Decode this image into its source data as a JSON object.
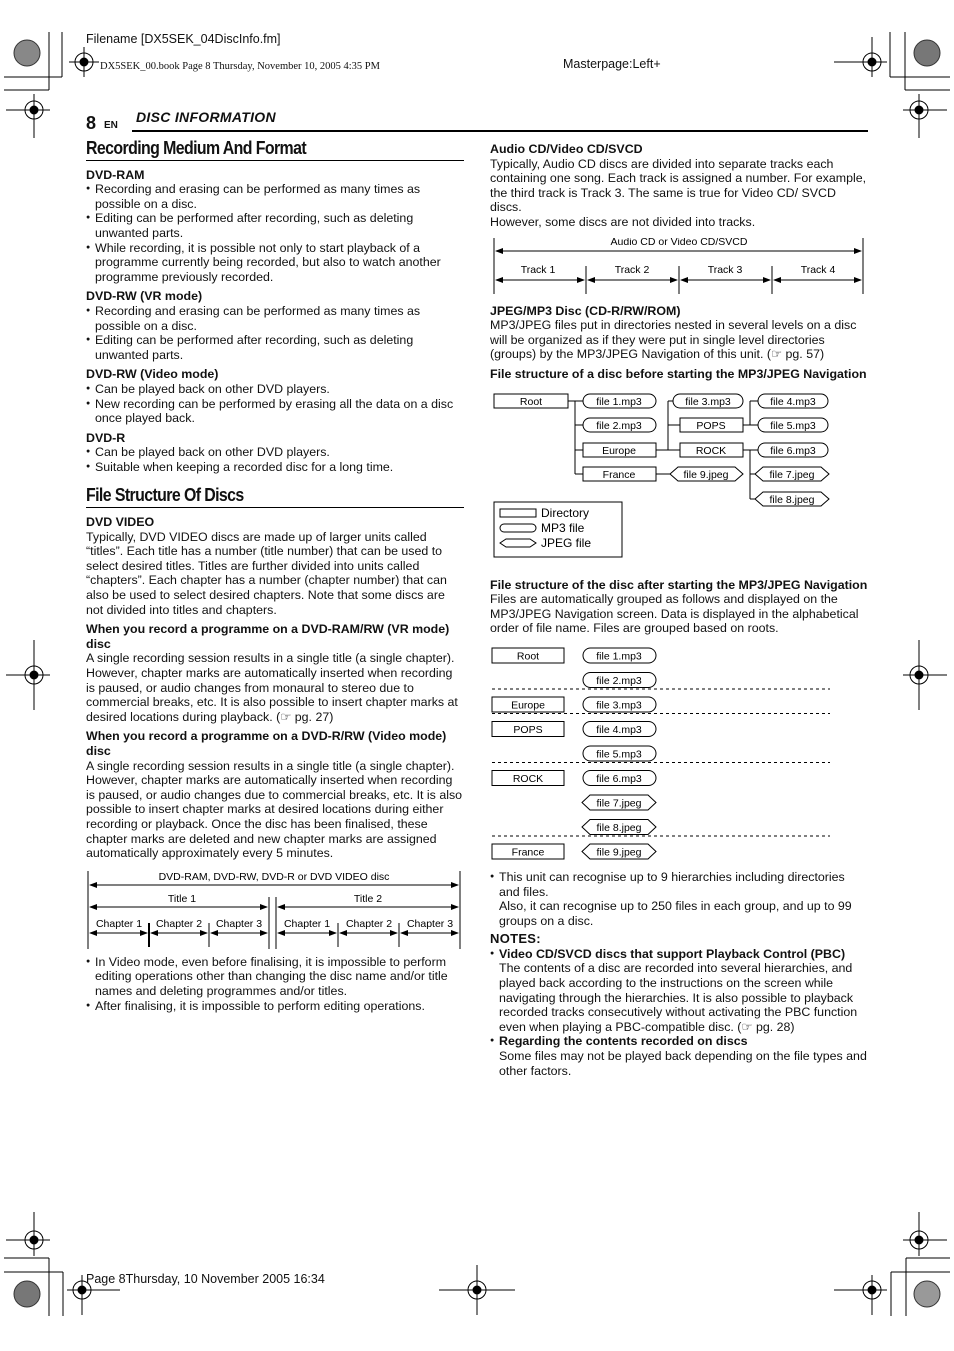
{
  "print_header": {
    "filename": "Filename [DX5SEK_04DiscInfo.fm]",
    "book_line": "DX5SEK_00.book  Page 8  Thursday, November 10, 2005  4:35 PM",
    "masterpage": "Masterpage:Left+"
  },
  "page": {
    "number": "8",
    "lang": "EN",
    "section": "DISC INFORMATION"
  },
  "left": {
    "recording": {
      "title": "Recording Medium And Format",
      "groups": [
        {
          "name": "DVD-RAM",
          "items": [
            "Recording and erasing can be performed as many times as possible on a disc.",
            "Editing can be performed after recording, such as deleting unwanted parts.",
            "While recording, it is possible not only to start playback of a programme currently being recorded, but also to watch another programme previously recorded."
          ]
        },
        {
          "name": "DVD-RW (VR mode)",
          "items": [
            "Recording and erasing can be performed as many times as possible on a disc.",
            "Editing can be performed after recording, such as deleting unwanted parts."
          ]
        },
        {
          "name": "DVD-RW (Video mode)",
          "items": [
            "Can be played back on other DVD players.",
            "New recording can be performed by erasing all the data on a disc once played back."
          ]
        },
        {
          "name": "DVD-R",
          "items": [
            "Can be played back on other DVD players.",
            "Suitable when keeping a recorded disc for a long time."
          ]
        }
      ]
    },
    "file_structure": {
      "title": "File Structure Of Discs",
      "dvd_video_heading": "DVD VIDEO",
      "dvd_video_text": "Typically, DVD VIDEO discs are made up of larger units called “titles”. Each title has a number (title number) that can be used to select desired titles. Titles are further divided into units called “chapters”. Each chapter has a number (chapter number) that can also be used to select desired chapters. Note that some discs are not divided into titles and chapters.",
      "vr_heading": "When you record a programme on a DVD-RAM/RW (VR mode) disc",
      "vr_text": "A single recording session results in a single title (a single chapter). However, chapter marks are automatically inserted when recording is paused, or audio changes from monaural to stereo due to commercial breaks, etc. It is also possible to insert chapter marks at desired locations during playback. (☞ pg. 27)",
      "video_heading": "When you record a programme on a DVD-R/RW (Video mode) disc",
      "video_text": "A single recording session results in a single title (a single chapter). However, chapter marks are automatically inserted when recording is paused, or audio changes due to commercial breaks, etc. It is also possible to insert chapter marks at desired locations during either recording or playback. Once the disc has been finalised, these chapter marks are deleted and new chapter marks are assigned automatically approximately every 5 minutes.",
      "diagram": {
        "disc_label": "DVD-RAM, DVD-RW, DVD-R or DVD VIDEO disc",
        "titles": [
          {
            "label": "Title 1",
            "chapters": [
              "Chapter 1",
              "Chapter 2",
              "Chapter 3"
            ]
          },
          {
            "label": "Title 2",
            "chapters": [
              "Chapter 1",
              "Chapter 2",
              "Chapter 3"
            ]
          }
        ]
      },
      "after_items": [
        "In Video mode, even before finalising, it is impossible to perform editing operations other than changing the disc name and/or title names and deleting programmes and/or titles.",
        "After finalising, it is impossible to perform editing operations."
      ]
    }
  },
  "right": {
    "audio_heading": "Audio CD/Video CD/SVCD",
    "audio_text": "Typically, Audio CD discs are divided into separate tracks each containing one song. Each track is assigned a number. For example, the third track is Track 3. The same is true for Video CD/ SVCD discs.",
    "audio_text2": "However, some discs are not divided into tracks.",
    "track_diagram": {
      "label": "Audio CD or Video CD/SVCD",
      "tracks": [
        "Track 1",
        "Track 2",
        "Track 3",
        "Track 4"
      ]
    },
    "jpeg_heading": "JPEG/MP3 Disc (CD-R/RW/ROM)",
    "jpeg_text": "MP3/JPEG files put in directories nested in several levels on a disc will be organized as if they were put in single level directories (groups) by the MP3/JPEG Navigation of this unit. (☞ pg. 57)",
    "before_heading": "File structure of a disc before starting the MP3/JPEG Navigation",
    "tree": {
      "root": "Root",
      "file1": "file 1.mp3",
      "file2": "file 2.mp3",
      "europe": "Europe",
      "france": "France",
      "file3": "file 3.mp3",
      "pops": "POPS",
      "rock": "ROCK",
      "file9": "file 9.jpeg",
      "file4": "file 4.mp3",
      "file5": "file 5.mp3",
      "file6": "file 6.mp3",
      "file7": "file 7.jpeg",
      "file8": "file 8.jpeg"
    },
    "legend": {
      "directory": "Directory",
      "mp3": "MP3 file",
      "jpeg": "JPEG file"
    },
    "after_heading": "File structure of the disc after starting the MP3/JPEG Navigation",
    "after_text": "Files are automatically grouped as follows and displayed on the MP3/JPEG Navigation screen. Data is displayed in the alphabetical order of file name. Files are grouped based on roots.",
    "groups": [
      {
        "dir": "Root",
        "files": [
          {
            "name": "file 1.mp3",
            "type": "mp3"
          },
          {
            "name": "file 2.mp3",
            "type": "mp3"
          }
        ]
      },
      {
        "dir": "Europe",
        "files": [
          {
            "name": "file 3.mp3",
            "type": "mp3"
          }
        ]
      },
      {
        "dir": "POPS",
        "files": [
          {
            "name": "file 4.mp3",
            "type": "mp3"
          },
          {
            "name": "file 5.mp3",
            "type": "mp3"
          }
        ]
      },
      {
        "dir": "ROCK",
        "files": [
          {
            "name": "file 6.mp3",
            "type": "mp3"
          },
          {
            "name": "file 7.jpeg",
            "type": "jpeg"
          },
          {
            "name": "file 8.jpeg",
            "type": "jpeg"
          }
        ]
      },
      {
        "dir": "France",
        "files": [
          {
            "name": "file 9.jpeg",
            "type": "jpeg"
          }
        ]
      }
    ],
    "limit_text": "This unit can recognise up to 9 hierarchies including directories and files.",
    "limit_text2": "Also, it can recognise up to 250 files in each group, and up to 99 groups on a disc.",
    "notes_title": "NOTES:",
    "notes": [
      {
        "heading": "Video CD/SVCD discs that support Playback Control (PBC)",
        "text": "The contents of a disc are recorded into several hierarchies, and played back according to the instructions on the screen while navigating through the hierarchies. It is also possible to playback recorded tracks consecutively without activating the PBC function even when playing a PBC-compatible disc. (☞ pg. 28)"
      },
      {
        "heading": "Regarding the contents recorded on discs",
        "text": "Some files may not be played back depending on the file types and other factors."
      }
    ]
  },
  "print_footer": "Page 8Thursday, 10 November 2005  16:34"
}
